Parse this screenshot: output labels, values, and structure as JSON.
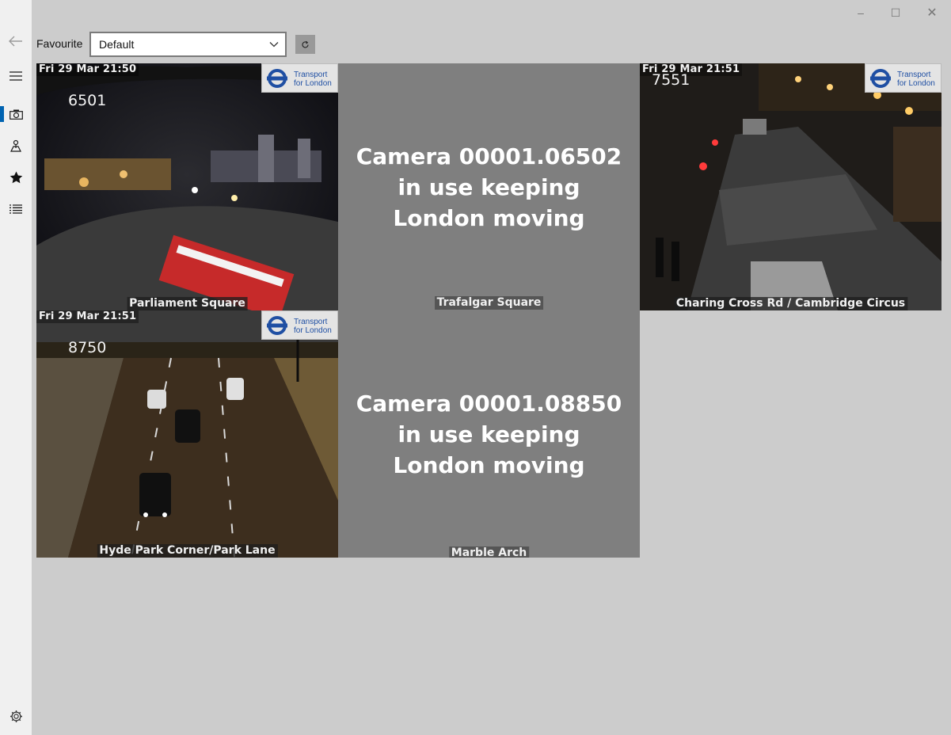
{
  "window": {
    "controls": {
      "minimize": "–",
      "maximize": "☐",
      "close": "✕"
    }
  },
  "rail": {
    "icons": [
      "back-arrow-icon",
      "hamburger-menu-icon",
      "camera-icon",
      "map-pin-icon",
      "star-icon",
      "list-icon",
      "settings-gear-icon"
    ],
    "accent": "#0063b1"
  },
  "favourite": {
    "label": "Favourite",
    "selected": "Default"
  },
  "tiles": [
    {
      "type": "camera",
      "timestamp": "Fri 29 Mar 21:50",
      "camera_number": "6501",
      "location": "Parliament Square",
      "logo": [
        "Transport",
        "for London"
      ]
    },
    {
      "type": "in-use",
      "message": "Camera 00001.06502 in use keeping London moving",
      "location": "Trafalgar Square"
    },
    {
      "type": "camera",
      "timestamp": "Fri 29 Mar 21:51",
      "camera_number": "7551",
      "location": "Charing Cross Rd / Cambridge Circus",
      "logo": [
        "Transport",
        "for London"
      ]
    },
    {
      "type": "camera",
      "timestamp": "Fri 29 Mar 21:51",
      "camera_number": "8750",
      "location": "Hyde Park Corner/Park Lane",
      "logo": [
        "Transport",
        "for London"
      ]
    },
    {
      "type": "in-use",
      "message": "Camera 00001.08850 in use keeping London moving",
      "location": "Marble Arch"
    }
  ]
}
